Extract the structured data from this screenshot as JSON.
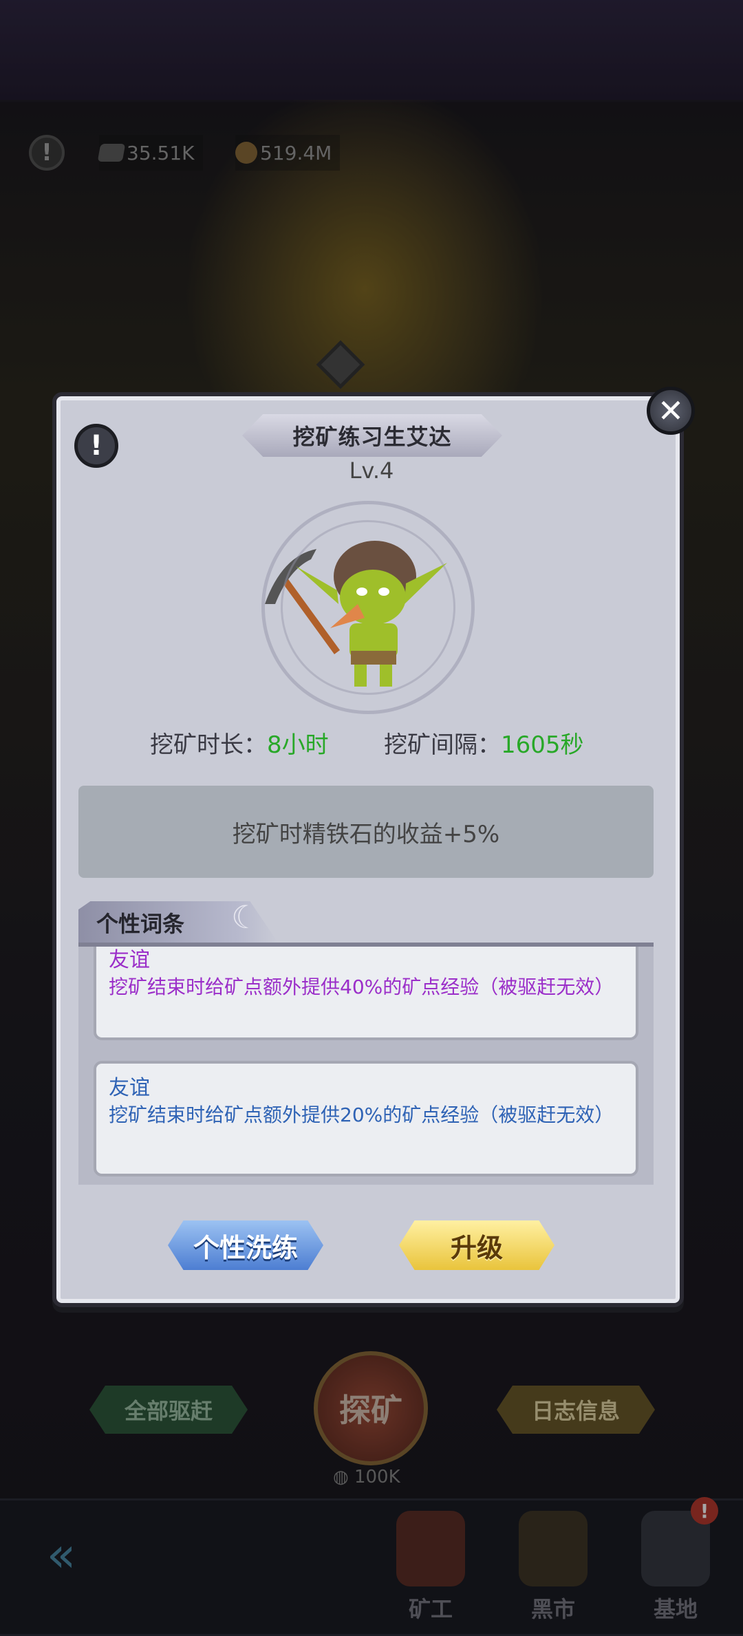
{
  "hud": {
    "iron_amount": "35.51K",
    "gold_amount": "519.4M"
  },
  "dialog": {
    "title": "挖矿练习生艾达",
    "level": "Lv.4",
    "duration_label": "挖矿时长：",
    "duration_value": "8小时",
    "interval_label": "挖矿间隔：",
    "interval_value": "1605秒",
    "bonus_text": "挖矿时精铁石的收益+5%",
    "section_title": "个性词条",
    "traits": [
      {
        "name": "友谊",
        "description": "挖矿结束时给矿点额外提供40%的矿点经验（被驱赶无效）",
        "color": "#9b2fc9"
      },
      {
        "name": "友谊",
        "description": "挖矿结束时给矿点额外提供20%的矿点经验（被驱赶无效）",
        "color": "#2f63b5"
      }
    ],
    "reroll_button": "个性洗练",
    "upgrade_button": "升级"
  },
  "bottom": {
    "drive_all_button": "全部驱赶",
    "explore_button": "探矿",
    "explore_cost": "100K",
    "log_button": "日志信息"
  },
  "nav": {
    "items": [
      {
        "label": "矿工",
        "icon": "miner-icon"
      },
      {
        "label": "黑市",
        "icon": "market-icon"
      },
      {
        "label": "基地",
        "icon": "base-icon"
      }
    ],
    "base_badge": "!"
  }
}
